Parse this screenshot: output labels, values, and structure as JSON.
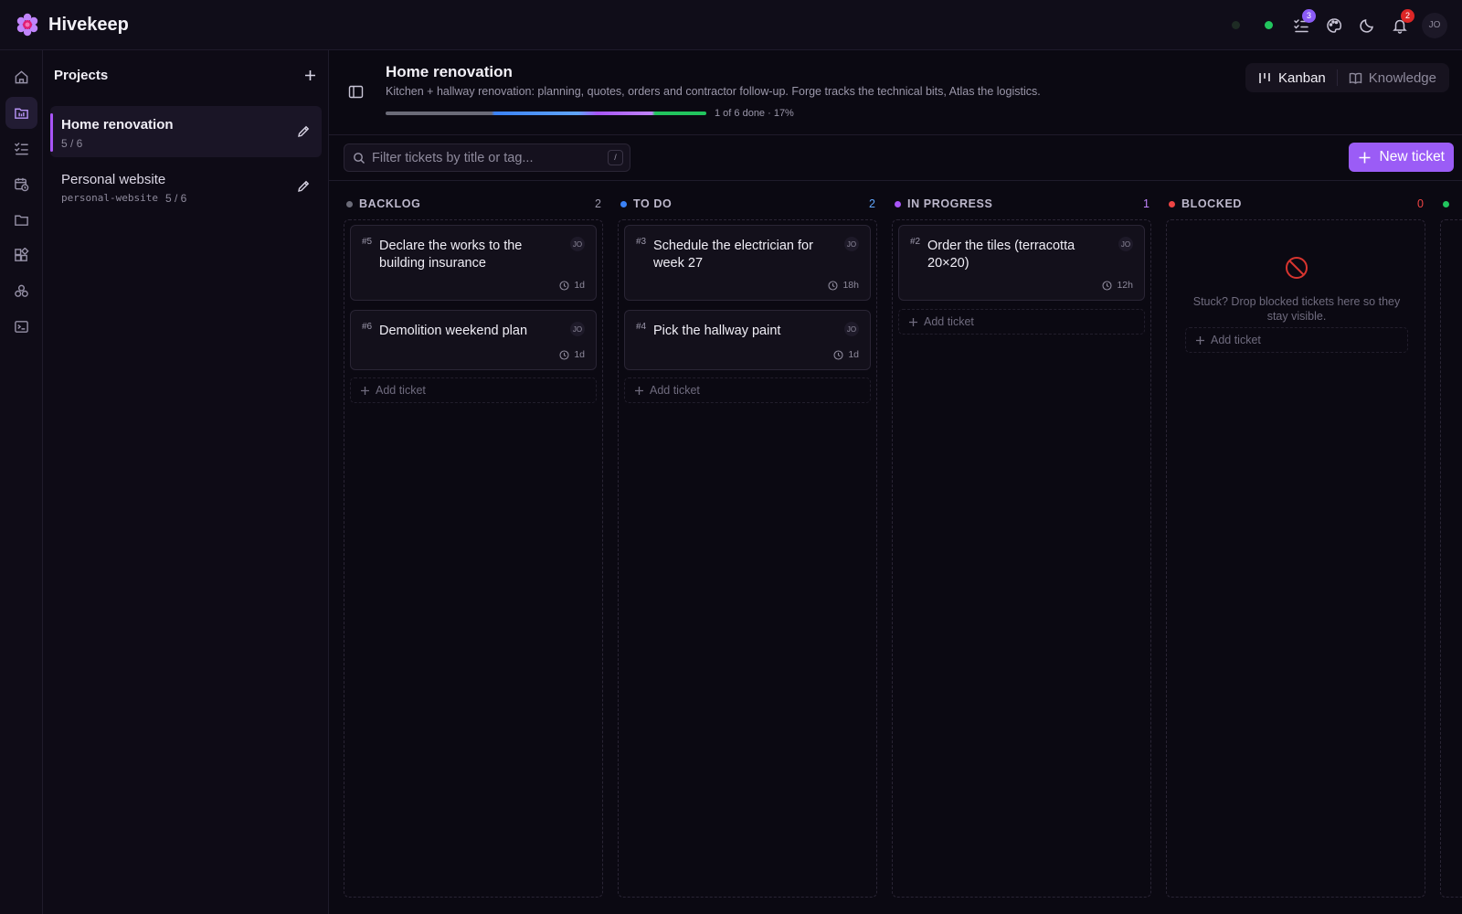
{
  "app": {
    "name": "Hivekeep"
  },
  "topbar": {
    "tasks_badge": "3",
    "notifications_badge": "2",
    "avatar": "JO"
  },
  "sidebar": {
    "title": "Projects",
    "projects": [
      {
        "name": "Home renovation",
        "slug": "",
        "progress": "5 / 6",
        "active": true
      },
      {
        "name": "Personal website",
        "slug": "personal-website",
        "progress": "5 / 6",
        "active": false
      }
    ]
  },
  "header": {
    "title": "Home renovation",
    "description": "Kitchen + hallway renovation: planning, quotes, orders and contractor follow-up. Forge tracks the technical bits, Atlas the logistics.",
    "progress_text": "1 of 6 done · 17%",
    "progress_fraction": 0.17,
    "views": {
      "kanban": "Kanban",
      "knowledge": "Knowledge"
    }
  },
  "toolbar": {
    "filter_placeholder": "Filter tickets by title or tag...",
    "filter_shortcut": "/",
    "new_ticket_label": "New ticket"
  },
  "columns": [
    {
      "title": "BACKLOG",
      "count": "2",
      "color": "#6b6b78",
      "count_color": "#9b97aa",
      "cards": [
        {
          "num": "#5",
          "title": "Declare the works to the building insurance",
          "assignee": "JO",
          "age": "1d"
        },
        {
          "num": "#6",
          "title": "Demolition weekend plan",
          "assignee": "JO",
          "age": "1d"
        }
      ],
      "add_label": "Add ticket"
    },
    {
      "title": "TO DO",
      "count": "2",
      "color": "#3b82f6",
      "count_color": "#60a5fa",
      "cards": [
        {
          "num": "#3",
          "title": "Schedule the electrician for week 27",
          "assignee": "JO",
          "age": "18h"
        },
        {
          "num": "#4",
          "title": "Pick the hallway paint",
          "assignee": "JO",
          "age": "1d"
        }
      ],
      "add_label": "Add ticket"
    },
    {
      "title": "IN PROGRESS",
      "count": "1",
      "color": "#a855f7",
      "count_color": "#c084fc",
      "cards": [
        {
          "num": "#2",
          "title": "Order the tiles (terracotta 20×20)",
          "assignee": "JO",
          "age": "12h"
        }
      ],
      "add_label": "Add ticket"
    },
    {
      "title": "BLOCKED",
      "count": "0",
      "color": "#ef4444",
      "count_color": "#ef4444",
      "empty_text": "Stuck? Drop blocked tickets here so they stay visible.",
      "add_label": "Add ticket"
    }
  ],
  "icons": {
    "rail": [
      "home-icon",
      "projects-icon",
      "tasks-icon",
      "schedule-icon",
      "folder-icon",
      "widgets-icon",
      "agents-icon",
      "terminal-icon"
    ]
  }
}
